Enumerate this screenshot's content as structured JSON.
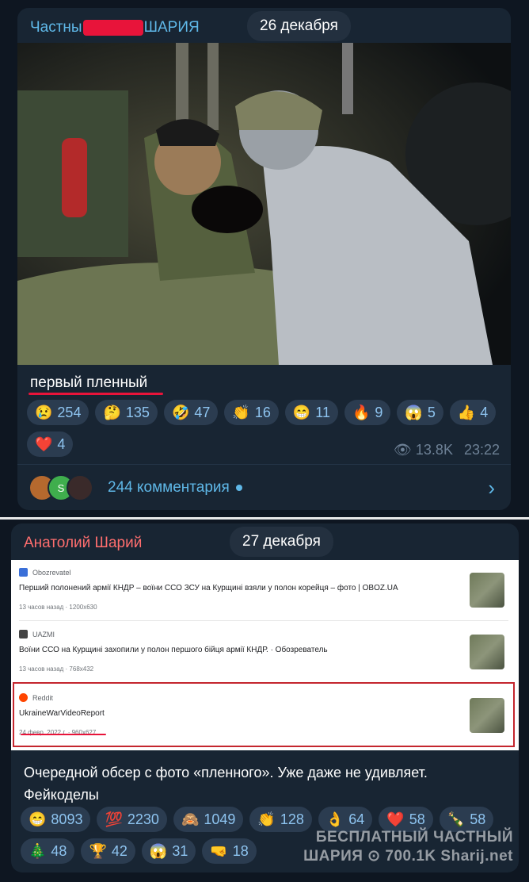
{
  "post1": {
    "author_pre": "Частны",
    "author_post": "ШАРИЯ",
    "date": "26 декабря",
    "caption": "первый пленный",
    "reactions": [
      {
        "emoji": "😢",
        "count": "254"
      },
      {
        "emoji": "🤔",
        "count": "135"
      },
      {
        "emoji": "🤣",
        "count": "47"
      },
      {
        "emoji": "👏",
        "count": "16"
      },
      {
        "emoji": "😁",
        "count": "11"
      },
      {
        "emoji": "🔥",
        "count": "9"
      },
      {
        "emoji": "😱",
        "count": "5"
      },
      {
        "emoji": "👍",
        "count": "4"
      },
      {
        "emoji": "❤️",
        "count": "4"
      }
    ],
    "views": "13.8K",
    "time": "23:22",
    "comments": "244 комментария",
    "avatar_letter": "S"
  },
  "post2": {
    "author": "Анатолий Шарий",
    "date": "27 декабря",
    "search_results": [
      {
        "source": "Obozrevatel",
        "title": "Перший полонений армії КНДР – воїни ССО ЗСУ на Курщині взяли у полон корейця – фото | OBOZ.UA",
        "sub": "13 часов назад · 1200x630",
        "fav_color": "#3a6fd8"
      },
      {
        "source": "UAZMI",
        "title": "Воїни ССО на Курщині захопили у полон першого бійця армії КНДР. · Обозреватель",
        "sub": "13 часов назад · 768x432",
        "fav_color": "#444444"
      },
      {
        "source": "Reddit",
        "title": "UkraineWarVideoReport",
        "sub": "24 февр. 2022 г. · 960x627",
        "fav_color": "#ff4500"
      }
    ],
    "caption": "Очередной обсер с фото «пленного». Уже даже не удивляет. Фейкоделы",
    "reactions": [
      {
        "emoji": "😁",
        "count": "8093"
      },
      {
        "emoji": "💯",
        "count": "2230"
      },
      {
        "emoji": "🙈",
        "count": "1049"
      },
      {
        "emoji": "👏",
        "count": "128"
      },
      {
        "emoji": "👌",
        "count": "64"
      },
      {
        "emoji": "❤️",
        "count": "58"
      },
      {
        "emoji": "🍾",
        "count": "58"
      },
      {
        "emoji": "🎄",
        "count": "48"
      },
      {
        "emoji": "🏆",
        "count": "42"
      },
      {
        "emoji": "😱",
        "count": "31"
      },
      {
        "emoji": "🤜",
        "count": "18"
      }
    ]
  },
  "watermark": {
    "line1": "БЕСПЛАТНЫЙ ЧАСТНЫЙ",
    "line2": "ШАРИЯ ⊙ 700.1K Sharij.net"
  }
}
